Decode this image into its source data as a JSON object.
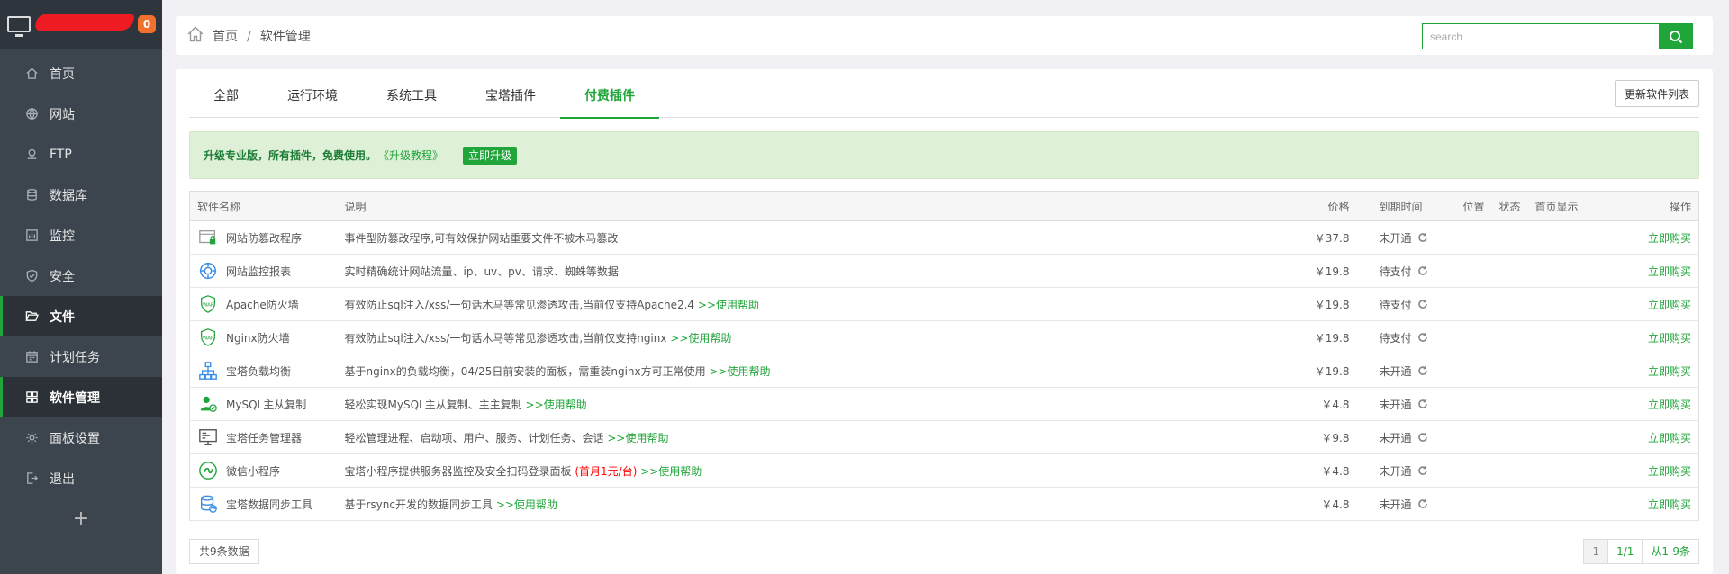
{
  "sidebar": {
    "badge": "0",
    "items": [
      {
        "label": "首页",
        "icon": "home-icon"
      },
      {
        "label": "网站",
        "icon": "globe-icon"
      },
      {
        "label": "FTP",
        "icon": "ftp-icon"
      },
      {
        "label": "数据库",
        "icon": "database-icon"
      },
      {
        "label": "监控",
        "icon": "monitor-icon"
      },
      {
        "label": "安全",
        "icon": "shield-icon"
      },
      {
        "label": "文件",
        "icon": "folder-icon"
      },
      {
        "label": "计划任务",
        "icon": "calendar-icon"
      },
      {
        "label": "软件管理",
        "icon": "grid-icon"
      },
      {
        "label": "面板设置",
        "icon": "gear-icon"
      },
      {
        "label": "退出",
        "icon": "logout-icon"
      }
    ],
    "add_label": "+"
  },
  "header": {
    "breadcrumb_home": "首页",
    "breadcrumb_sep": "/",
    "breadcrumb_current": "软件管理",
    "search_placeholder": "search"
  },
  "tabs": [
    "全部",
    "运行环境",
    "系统工具",
    "宝塔插件",
    "付费插件"
  ],
  "refresh_label": "更新软件列表",
  "alert": {
    "text": "升级专业版，所有插件，免费使用。",
    "link": "《升级教程》",
    "button": "立即升级"
  },
  "table": {
    "headers": {
      "name": "软件名称",
      "desc": "说明",
      "price": "价格",
      "expire": "到期时间",
      "position": "位置",
      "status": "状态",
      "homepage": "首页显示",
      "action": "操作"
    },
    "rows": [
      {
        "name": "网站防篡改程序",
        "icon": "tamper-icon",
        "desc": "事件型防篡改程序,可有效保护网站重要文件不被木马篡改",
        "desc_red": "",
        "help": "",
        "price": "￥37.8",
        "expire": "未开通",
        "action": "立即购买"
      },
      {
        "name": "网站监控报表",
        "icon": "site-monitor-icon",
        "desc": "实时精确统计网站流量、ip、uv、pv、请求、蜘蛛等数据",
        "desc_red": "",
        "help": "",
        "price": "￥19.8",
        "expire": "待支付",
        "action": "立即购买"
      },
      {
        "name": "Apache防火墙",
        "icon": "waf-icon",
        "desc": "有效防止sql注入/xss/一句话木马等常见渗透攻击,当前仅支持Apache2.4 ",
        "desc_red": "",
        "help": ">>使用帮助",
        "price": "￥19.8",
        "expire": "待支付",
        "action": "立即购买"
      },
      {
        "name": "Nginx防火墙",
        "icon": "waf-icon",
        "desc": "有效防止sql注入/xss/一句话木马等常见渗透攻击,当前仅支持nginx ",
        "desc_red": "",
        "help": ">>使用帮助",
        "price": "￥19.8",
        "expire": "待支付",
        "action": "立即购买"
      },
      {
        "name": "宝塔负载均衡",
        "icon": "load-balance-icon",
        "desc": "基于nginx的负载均衡，04/25日前安装的面板，需重装nginx方可正常使用 ",
        "desc_red": "",
        "help": ">>使用帮助",
        "price": "￥19.8",
        "expire": "未开通",
        "action": "立即购买"
      },
      {
        "name": "MySQL主从复制",
        "icon": "mysql-replication-icon",
        "desc": "轻松实现MySQL主从复制、主主复制 ",
        "desc_red": "",
        "help": ">>使用帮助",
        "price": "￥4.8",
        "expire": "未开通",
        "action": "立即购买"
      },
      {
        "name": "宝塔任务管理器",
        "icon": "task-manager-icon",
        "desc": "轻松管理进程、启动项、用户、服务、计划任务、会话 ",
        "desc_red": "",
        "help": ">>使用帮助",
        "price": "￥9.8",
        "expire": "未开通",
        "action": "立即购买"
      },
      {
        "name": "微信小程序",
        "icon": "wechat-miniapp-icon",
        "desc": "宝塔小程序提供服务器监控及安全扫码登录面板 ",
        "desc_red": "(首月1元/台)",
        "help": " >>使用帮助",
        "price": "￥4.8",
        "expire": "未开通",
        "action": "立即购买"
      },
      {
        "name": "宝塔数据同步工具",
        "icon": "data-sync-icon",
        "desc": "基于rsync开发的数据同步工具 ",
        "desc_red": "",
        "help": ">>使用帮助",
        "price": "￥4.8",
        "expire": "未开通",
        "action": "立即购买"
      }
    ]
  },
  "footer": {
    "total": "共9条数据",
    "page": "1",
    "pages": "1/1",
    "range": "从1-9条"
  },
  "colors": {
    "accent": "#20a53a",
    "price": "#fc6d26",
    "sidebar_bg": "#3c444d",
    "alert_bg": "#dff0d8"
  }
}
